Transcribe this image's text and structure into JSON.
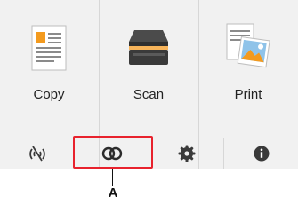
{
  "home": {
    "tiles": [
      {
        "label": "Copy",
        "icon": "copy-icon"
      },
      {
        "label": "Scan",
        "icon": "scanner-icon"
      },
      {
        "label": "Print",
        "icon": "print-photo-icon"
      }
    ]
  },
  "bottom_bar": {
    "items": [
      {
        "icon": "wireless-off-icon"
      },
      {
        "icon": "link-icon"
      },
      {
        "icon": "gear-icon"
      },
      {
        "icon": "info-icon"
      }
    ],
    "highlight_color": "#e8222d"
  },
  "callout": {
    "letter": "A"
  }
}
